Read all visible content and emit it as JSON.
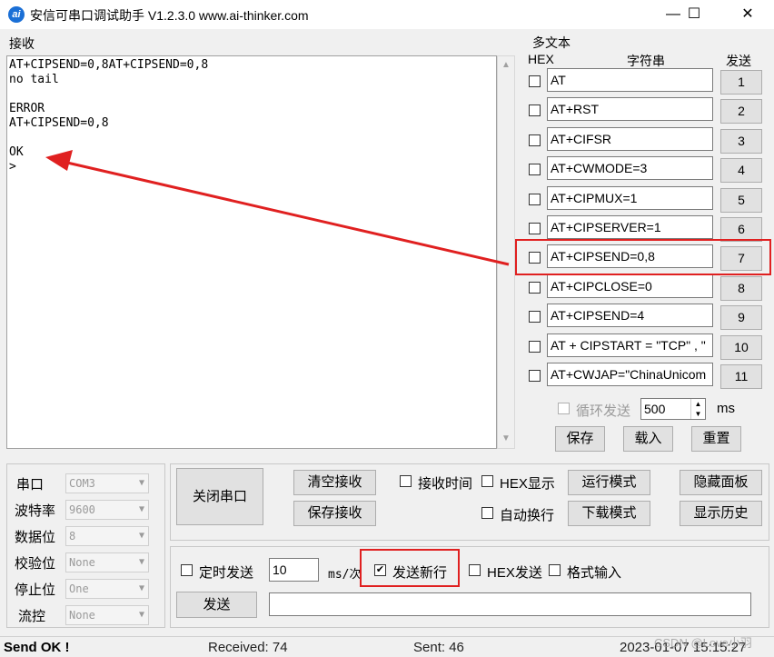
{
  "window": {
    "title": "安信可串口调试助手 V1.2.3.0    www.ai-thinker.com",
    "icon_text": "ai",
    "minimize_glyph": "—",
    "maximize_glyph": "☐",
    "close_glyph": "✕"
  },
  "receive": {
    "label": "接收",
    "lines": [
      "AT+CIPSEND=0,8AT+CIPSEND=0,8",
      "no tail",
      "",
      "ERROR",
      "AT+CIPSEND=0,8",
      "",
      "OK",
      ">"
    ]
  },
  "multi_text": {
    "label": "多文本",
    "col_hex": "HEX",
    "col_string": "字符串",
    "col_send": "发送",
    "rows": [
      {
        "text": "AT",
        "btn": "1"
      },
      {
        "text": "AT+RST",
        "btn": "2"
      },
      {
        "text": "AT+CIFSR",
        "btn": "3"
      },
      {
        "text": "AT+CWMODE=3",
        "btn": "4"
      },
      {
        "text": "AT+CIPMUX=1",
        "btn": "5"
      },
      {
        "text": "AT+CIPSERVER=1",
        "btn": "6"
      },
      {
        "text": "AT+CIPSEND=0,8",
        "btn": "7"
      },
      {
        "text": "AT+CIPCLOSE=0",
        "btn": "8"
      },
      {
        "text": "AT+CIPSEND=4",
        "btn": "9"
      },
      {
        "text": "AT + CIPSTART = \"TCP\" , \"",
        "btn": "10"
      },
      {
        "text": "AT+CWJAP=\"ChinaUnicom",
        "btn": "11"
      }
    ],
    "loop_label": "循环发送",
    "loop_value": "500",
    "loop_unit": "ms",
    "save": "保存",
    "load": "载入",
    "reset": "重置"
  },
  "serial": {
    "port_label": "串口",
    "port_value": "COM3",
    "baud_label": "波特率",
    "baud_value": "9600",
    "databits_label": "数据位",
    "databits_value": "8",
    "parity_label": "校验位",
    "parity_value": "None",
    "stopbits_label": "停止位",
    "stopbits_value": "One",
    "flow_label": "流控",
    "flow_value": "None"
  },
  "controls": {
    "close_port": "关闭串口",
    "clear_recv": "清空接收",
    "save_recv": "保存接收",
    "recv_time": "接收时间",
    "hex_display": "HEX显示",
    "run_mode": "运行模式",
    "hide_panel": "隐藏面板",
    "auto_wrap": "自动换行",
    "download_mode": "下载模式",
    "show_history": "显示历史"
  },
  "send_panel": {
    "timed_send": "定时发送",
    "interval_value": "10",
    "interval_unit": "ms/次",
    "send_newline": "发送新行",
    "send_newline_checked": true,
    "hex_send": "HEX发送",
    "format_input": "格式输入",
    "send_button": "发送",
    "send_input": ""
  },
  "status": {
    "message": "Send OK !",
    "received": "Received: 74",
    "sent": "Sent: 46",
    "datetime": "2023-01-07 15:15:27",
    "watermark": "CSDN @Love小羽"
  },
  "colors": {
    "annotation_red": "#e02020"
  }
}
